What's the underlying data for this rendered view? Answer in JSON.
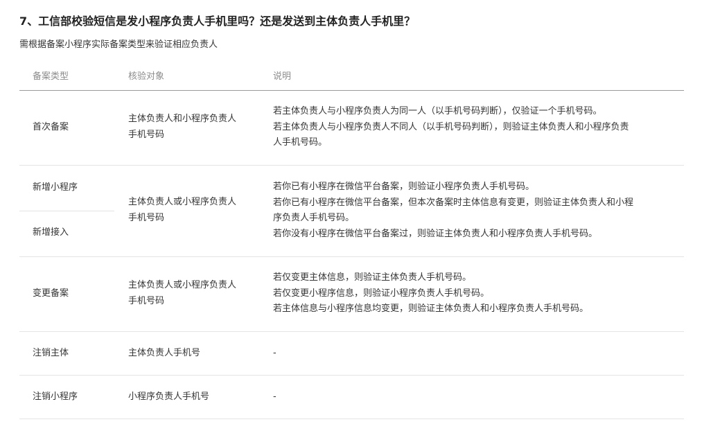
{
  "heading": "7、工信部校验短信是发小程序负责人手机里吗？还是发送到主体负责人手机里？",
  "description": "需根据备案小程序实际备案类型来验证相应负责人",
  "table": {
    "headers": [
      "备案类型",
      "核验对象",
      "说明"
    ],
    "rows": [
      {
        "types": [
          "首次备案"
        ],
        "target": [
          "主体负责人和小程序负责人",
          "手机号码"
        ],
        "notes": [
          "若主体负责人与小程序负责人为同一人（以手机号码判断），仅验证一个手机号码。",
          "若主体负责人与小程序负责人不同人（以手机号码判断），则验证主体负责人和小程序负责",
          "人手机号码。"
        ]
      },
      {
        "types": [
          "新增小程序",
          "新增接入"
        ],
        "target": [
          "主体负责人或小程序负责人",
          "手机号码"
        ],
        "notes": [
          "若你已有小程序在微信平台备案，则验证小程序负责人手机号码。",
          "若你已有小程序在微信平台备案，但本次备案时主体信息有变更，则验证主体负责人和小程",
          "序负责人手机号码。",
          "若你没有小程序在微信平台备案过，则验证主体负责人和小程序负责人手机号码。"
        ]
      },
      {
        "types": [
          "变更备案"
        ],
        "target": [
          "主体负责人或小程序负责人",
          "手机号码"
        ],
        "notes": [
          "若仅变更主体信息，则验证主体负责人手机号码。",
          "若仅变更小程序信息，则验证小程序负责人手机号码。",
          "若主体信息与小程序信息均变更，则验证主体负责人和小程序负责人手机号码。"
        ]
      },
      {
        "types": [
          "注销主体"
        ],
        "target": [
          "主体负责人手机号"
        ],
        "notes": [
          "-"
        ]
      },
      {
        "types": [
          "注销小程序"
        ],
        "target": [
          "小程序负责人手机号"
        ],
        "notes": [
          "-"
        ]
      }
    ]
  }
}
